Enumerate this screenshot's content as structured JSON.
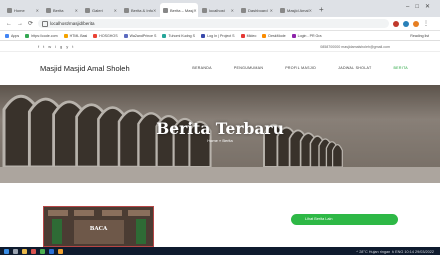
{
  "browser": {
    "tabs": [
      {
        "label": "Home",
        "active": false
      },
      {
        "label": "Berita",
        "active": false
      },
      {
        "label": "Galeri",
        "active": false
      },
      {
        "label": "Berita & Info",
        "active": false
      },
      {
        "label": "Berita – Masj",
        "active": true
      },
      {
        "label": "localhost",
        "active": false
      },
      {
        "label": "Dashboard",
        "active": false
      },
      {
        "label": "Masjid Amal",
        "active": false
      }
    ],
    "new_tab": "+",
    "url": "localhost/masjid/berita",
    "bookmarks": [
      "Apps",
      "https://code.com",
      "HTML Basi",
      "HOSGHOS",
      "Wa2andPrince S",
      "Tuhomi Kudng S",
      "Log In | Project S",
      "Mideo",
      "DeskMode",
      "Login - PR Gra"
    ],
    "reading_list": "Reading list"
  },
  "site": {
    "socials": [
      "f",
      "tw",
      "ig",
      "yt"
    ],
    "contact": "0858700000    masjidamalsholeh@gmail.com",
    "logo": "Masjid Masjid Amal Sholeh",
    "menu": [
      {
        "label": "BERANDA",
        "active": false
      },
      {
        "label": "PENGUMUMAN",
        "active": false
      },
      {
        "label": "PROFIL MASJID",
        "active": false
      },
      {
        "label": "JADWAL SHOLAT",
        "active": false
      },
      {
        "label": "BERITA",
        "active": true
      }
    ],
    "hero_title": "Berita Terbaru",
    "breadcrumb": "Home  »  Berita",
    "post_caption": "BACA",
    "cta_label": "Lihat Berita Lain"
  },
  "taskbar": {
    "tray": "^  28°C  Hujan ringan   ∧  ENG   10:14   29/03/2022"
  },
  "colors": {
    "accent": "#2eb846",
    "taskbar": "#0f1b2e"
  }
}
